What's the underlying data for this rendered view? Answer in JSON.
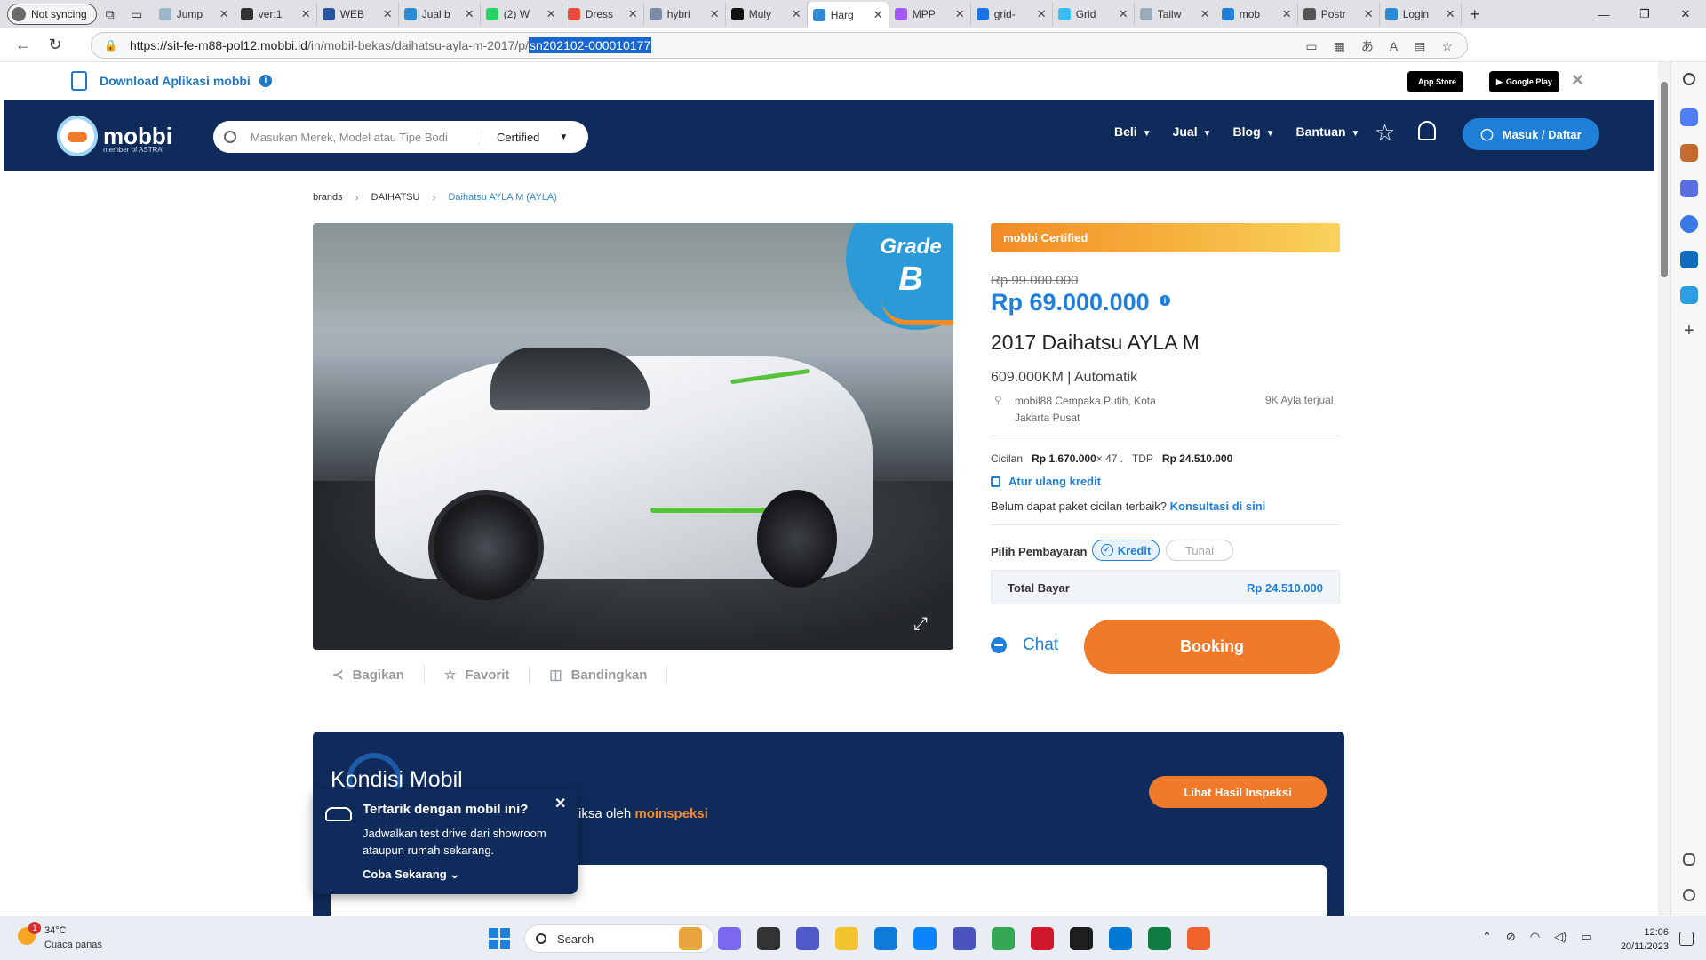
{
  "browser": {
    "profile_label": "Not syncing",
    "tabs": [
      {
        "title": "Jump",
        "color": "#9bb6c9"
      },
      {
        "title": "ver:1",
        "color": "#333333"
      },
      {
        "title": "WEB",
        "color": "#2b579a"
      },
      {
        "title": "Jual b",
        "color": "#2f8ad6"
      },
      {
        "title": "(2) W",
        "color": "#25d366"
      },
      {
        "title": "Dress",
        "color": "#e94b3c"
      },
      {
        "title": "hybri",
        "color": "#7f8ca8"
      },
      {
        "title": "Muly",
        "color": "#111111"
      },
      {
        "title": "Harg",
        "color": "#2f8ad6",
        "active": true
      },
      {
        "title": "MPP",
        "color": "#a259ff"
      },
      {
        "title": "grid-",
        "color": "#1a73e8"
      },
      {
        "title": "Grid",
        "color": "#38bdf8"
      },
      {
        "title": "Tailw",
        "color": "#9ab"
      },
      {
        "title": "mob",
        "color": "#1f7fd9"
      },
      {
        "title": "Postr",
        "color": "#555555"
      },
      {
        "title": "Login",
        "color": "#2f8ad6"
      }
    ],
    "url_host": "https://sit-fe-m88-pol12.mobbi.id",
    "url_path": "/in/mobil-bekas/daihatsu-ayla-m-2017/p/",
    "url_selected": "sn202102-000010177"
  },
  "banner": {
    "download_text": "Download Aplikasi mobbi",
    "app_store": "App Store",
    "google_play": "Google Play"
  },
  "nav": {
    "logo_name": "mobbi",
    "logo_sub": "member of ASTRA",
    "search_placeholder": "Masukan Merek, Model atau Tipe Bodi",
    "search_category": "Certified",
    "links": [
      "Beli",
      "Jual",
      "Blog",
      "Bantuan"
    ],
    "login_label": "Masuk / Daftar"
  },
  "breadcrumb": [
    "brands",
    "DAIHATSU",
    "Daihatsu AYLA M (AYLA)"
  ],
  "listing": {
    "grade_label": "Grade",
    "grade_value": "B",
    "actions": [
      "Bagikan",
      "Favorit",
      "Bandingkan"
    ],
    "certified_label": "mobbi Certified",
    "old_price": "Rp 99.000.000",
    "price": "Rp 69.000.000",
    "title": "2017 Daihatsu AYLA M",
    "meta": "609.000KM | Automatik",
    "location": "mobil88 Cempaka Putih, Kota Jakarta Pusat",
    "sold": "9K Ayla terjual",
    "cicilan_label": "Cicilan",
    "cicilan_value": "Rp 1.670.000",
    "cicilan_tenor": "× 47 .",
    "tdp_label": "TDP",
    "tdp_value": "Rp 24.510.000",
    "atur_ulang": "Atur ulang kredit",
    "konsultasi_prefix": "Belum dapat paket cicilan terbaik?",
    "konsultasi_link": "Konsultasi di sini",
    "pay_label": "Pilih Pembayaran",
    "pay_options": [
      "Kredit",
      "Tunai"
    ],
    "total_label": "Total Bayar",
    "total_value": "Rp 24.510.000",
    "chat_label": "Chat",
    "booking_label": "Booking"
  },
  "kondisi": {
    "title": "Kondisi Mobil",
    "sub_prefix": "riksa oleh",
    "sub_brand": "moinspeksi",
    "inspeksi_btn": "Lihat Hasil Inspeksi"
  },
  "popup": {
    "title": "Tertarik dengan mobil ini?",
    "body": "Jadwalkan test drive dari showroom ataupun rumah sekarang.",
    "cta": "Coba Sekarang"
  },
  "taskbar": {
    "temp": "34°C",
    "weather": "Cuaca panas",
    "weather_badge": "1",
    "search": "Search",
    "time": "12:06",
    "date": "20/11/2023"
  }
}
